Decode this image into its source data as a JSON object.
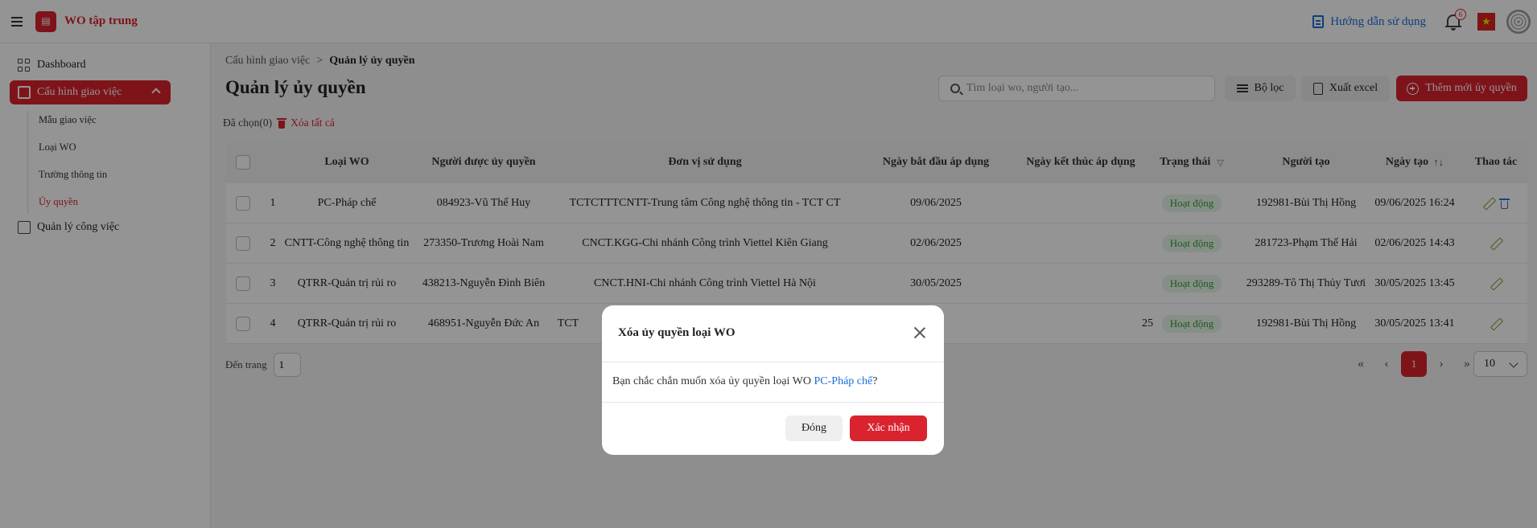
{
  "header": {
    "app_title": "WO tập trung",
    "guide_label": "Hướng dẫn sử dụng",
    "notification_count": "6"
  },
  "sidebar": {
    "items": [
      {
        "label": "Dashboard"
      },
      {
        "label": "Cấu hình giao việc"
      },
      {
        "label": "Quản lý công việc"
      }
    ],
    "sub_items": [
      {
        "label": "Mẫu giao việc"
      },
      {
        "label": "Loại WO"
      },
      {
        "label": "Trường thông tin"
      },
      {
        "label": "Ủy quyền"
      }
    ]
  },
  "breadcrumb": {
    "parent": "Cấu hình giao việc",
    "separator": ">",
    "current": "Quản lý ủy quyền"
  },
  "page_title": "Quản lý ủy quyền",
  "toolbar": {
    "search_placeholder": "Tìm loại wo, người tạo...",
    "filter_label": "Bộ lọc",
    "export_label": "Xuất excel",
    "add_label": "Thêm mới ủy quyền"
  },
  "selection": {
    "selected_label": "Đã chọn(0)",
    "delete_all_label": "Xóa tất cả"
  },
  "table": {
    "columns": {
      "type": "Loại WO",
      "delegate": "Người được ủy quyền",
      "unit": "Đơn vị sử dụng",
      "start": "Ngày bắt đầu áp dụng",
      "end": "Ngày kết thúc áp dụng",
      "status": "Trạng thái",
      "creator": "Người tạo",
      "created": "Ngày tạo",
      "actions": "Thao tác"
    },
    "rows": [
      {
        "no": "1",
        "type": "PC-Pháp chế",
        "delegate": "084923-Vũ Thế Huy",
        "unit": "TCTCTTTCNTT-Trung tâm Công nghệ thông tin - TCT CT",
        "start": "09/06/2025",
        "end": "",
        "status": "Hoạt động",
        "creator": "192981-Bùi Thị Hồng",
        "created": "09/06/2025 16:24"
      },
      {
        "no": "2",
        "type": "CNTT-Công nghệ thông tin",
        "delegate": "273350-Trương Hoài Nam",
        "unit": "CNCT.KGG-Chi nhánh Công trình Viettel Kiên Giang",
        "start": "02/06/2025",
        "end": "",
        "status": "Hoạt động",
        "creator": "281723-Phạm Thế Hải",
        "created": "02/06/2025 14:43"
      },
      {
        "no": "3",
        "type": "QTRR-Quản trị rủi ro",
        "delegate": "438213-Nguyễn Đình Biên",
        "unit": "CNCT.HNI-Chi nhánh Công trình Viettel Hà Nội",
        "start": "30/05/2025",
        "end": "",
        "status": "Hoạt động",
        "creator": "293289-Tô Thị Thủy Tươi",
        "created": "30/05/2025 13:45"
      },
      {
        "no": "4",
        "type": "QTRR-Quản trị rủi ro",
        "delegate": "468951-Nguyễn Đức An",
        "unit": "TCT",
        "start": "25",
        "end": "",
        "status": "Hoạt động",
        "creator": "192981-Bùi Thị Hồng",
        "created": "30/05/2025 13:41"
      }
    ]
  },
  "pagination": {
    "goto_label": "Đến trang",
    "goto_value": "1",
    "current_page": "1",
    "page_size": "10"
  },
  "modal": {
    "title": "Xóa ủy quyền loại WO",
    "message_prefix": "Bạn chắc chắn muốn xóa ủy quyền loại WO ",
    "message_link": "PC-Pháp chế",
    "message_suffix": "?",
    "close_label": "Đóng",
    "confirm_label": "Xác nhận"
  },
  "colors": {
    "brand": "#d9232e",
    "link": "#1a6dd6",
    "status_active": "#2e9e3e"
  }
}
